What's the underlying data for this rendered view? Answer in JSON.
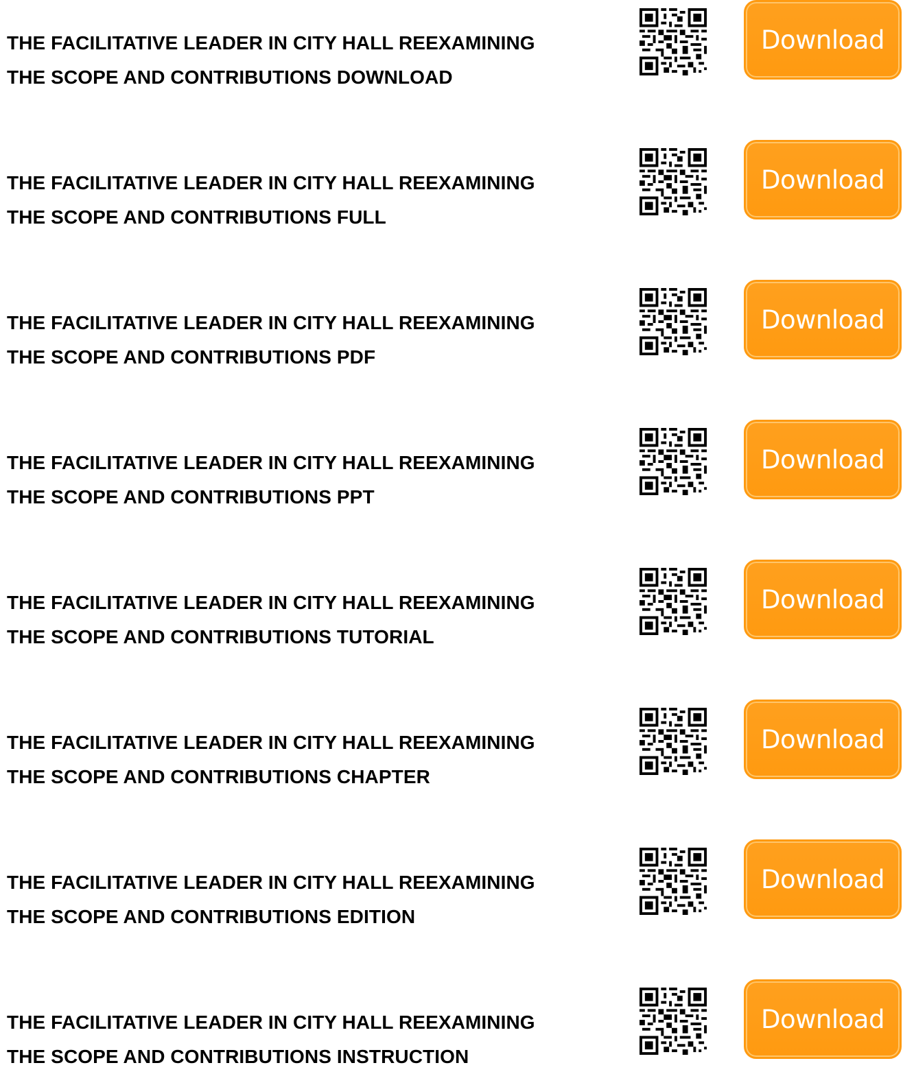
{
  "colors": {
    "button_bg": "#ff9e18",
    "button_text": "#ffffff",
    "title_text": "#000000"
  },
  "items": [
    {
      "line1": "THE FACILITATIVE LEADER IN CITY HALL REEXAMINING",
      "line2": "THE SCOPE AND CONTRIBUTIONS DOWNLOAD",
      "button": "Download",
      "qr_icon": "qr-code-icon"
    },
    {
      "line1": "THE FACILITATIVE LEADER IN CITY HALL REEXAMINING",
      "line2": "THE SCOPE AND CONTRIBUTIONS FULL",
      "button": "Download",
      "qr_icon": "qr-code-icon"
    },
    {
      "line1": "THE FACILITATIVE LEADER IN CITY HALL REEXAMINING",
      "line2": "THE SCOPE AND CONTRIBUTIONS PDF",
      "button": "Download",
      "qr_icon": "qr-code-icon"
    },
    {
      "line1": "THE FACILITATIVE LEADER IN CITY HALL REEXAMINING",
      "line2": "THE SCOPE AND CONTRIBUTIONS PPT",
      "button": "Download",
      "qr_icon": "qr-code-icon"
    },
    {
      "line1": "THE FACILITATIVE LEADER IN CITY HALL REEXAMINING",
      "line2": "THE SCOPE AND CONTRIBUTIONS TUTORIAL",
      "button": "Download",
      "qr_icon": "qr-code-icon"
    },
    {
      "line1": "THE FACILITATIVE LEADER IN CITY HALL REEXAMINING",
      "line2": "THE SCOPE AND CONTRIBUTIONS CHAPTER",
      "button": "Download",
      "qr_icon": "qr-code-icon"
    },
    {
      "line1": "THE FACILITATIVE LEADER IN CITY HALL REEXAMINING",
      "line2": "THE SCOPE AND CONTRIBUTIONS EDITION",
      "button": "Download",
      "qr_icon": "qr-code-icon"
    },
    {
      "line1": "THE FACILITATIVE LEADER IN CITY HALL REEXAMINING",
      "line2": "THE SCOPE AND CONTRIBUTIONS INSTRUCTION",
      "button": "Download",
      "qr_icon": "qr-code-icon"
    }
  ]
}
